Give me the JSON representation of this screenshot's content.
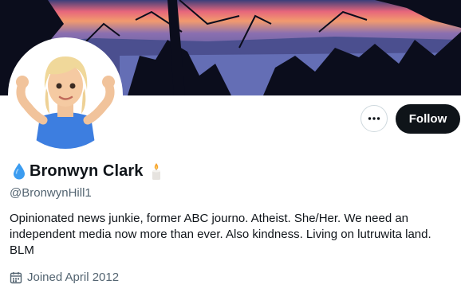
{
  "profile": {
    "display_name": "Bronwyn Clark",
    "handle": "@BronwynHill1",
    "bio": "Opinionated news junkie, former ABC journo. Atheist. She/Her. We need an independent media now more than ever. Also kindness. Living on lutruwita land. BLM",
    "joined": "Joined April 2012"
  },
  "actions": {
    "follow_label": "Follow"
  },
  "icons": {
    "name_prefix": "droplet-icon",
    "name_suffix": "candle-icon",
    "more": "more-icon",
    "joined": "calendar-icon"
  },
  "colors": {
    "follow_bg": "#0f1419",
    "secondary_text": "#536471",
    "droplet": "#3b9cf0"
  }
}
